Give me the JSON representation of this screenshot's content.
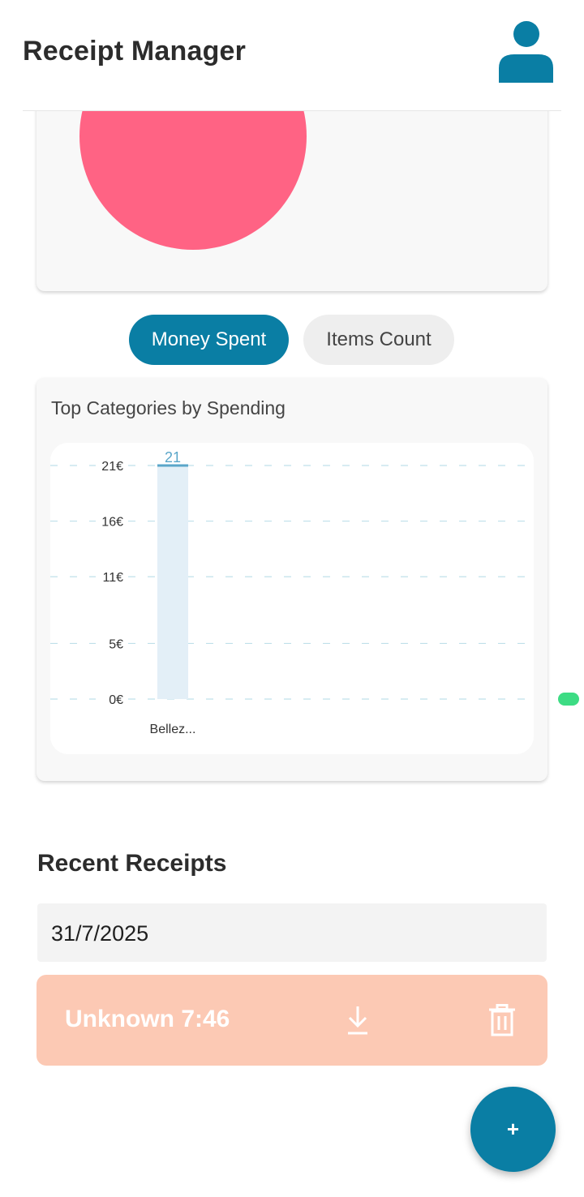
{
  "header": {
    "title": "Receipt Manager",
    "icon": "user-profile-icon"
  },
  "colors": {
    "accent": "#0a7ea4",
    "pie_slice": "#ff6384",
    "bar_fill": "#e3eff7",
    "receipt_card": "#fcc9b4"
  },
  "toggle": {
    "money_spent_label": "Money Spent",
    "items_count_label": "Items Count",
    "selected": "Money Spent"
  },
  "bar_chart_card": {
    "title": "Top Categories by Spending"
  },
  "chart_data": {
    "type": "bar",
    "title": "Top Categories by Spending",
    "categories": [
      "Bellez..."
    ],
    "series": [
      {
        "values": [
          21
        ]
      }
    ],
    "data_labels": [
      "21"
    ],
    "ylim": [
      0,
      21
    ],
    "yticks": [
      0,
      5,
      11,
      16,
      21
    ],
    "ytick_labels": [
      "0€",
      "5€",
      "11€",
      "16€",
      "21€"
    ],
    "grid": true
  },
  "recent": {
    "section_title": "Recent Receipts",
    "date": "31/7/2025",
    "receipts": [
      {
        "name": "Unknown 7:46",
        "download_icon": "download-icon",
        "delete_icon": "trash-icon"
      }
    ]
  },
  "fab": {
    "label": "+"
  }
}
